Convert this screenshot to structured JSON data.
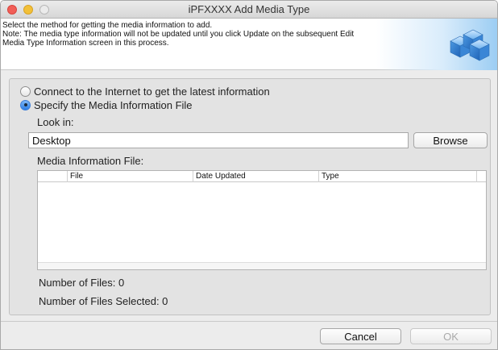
{
  "window": {
    "title": "iPFXXXX Add Media Type"
  },
  "header": {
    "lines": [
      "Select the method for getting the media information to add.",
      "Note: The media type information will not be updated until you click Update on the subsequent Edit",
      "Media Type Information screen in this process."
    ]
  },
  "options": {
    "internet_label": "Connect to the Internet to get the latest information",
    "file_label": "Specify the Media Information File",
    "selected": "file"
  },
  "look_in": {
    "label": "Look in:",
    "value": "Desktop",
    "browse_label": "Browse"
  },
  "file_list": {
    "label": "Media Information File:",
    "columns": [
      "",
      "File",
      "Date Updated",
      "Type",
      ""
    ],
    "rows": []
  },
  "counts": {
    "files_label": "Number of Files: 0",
    "selected_label": "Number of Files Selected: 0"
  },
  "footer": {
    "cancel_label": "Cancel",
    "ok_label": "OK"
  },
  "colors": {
    "radio_selected": "#2d7ee6",
    "header_gradient": "#9ccdf3"
  },
  "icons": {
    "header_graphic": "media-stack-icon"
  }
}
